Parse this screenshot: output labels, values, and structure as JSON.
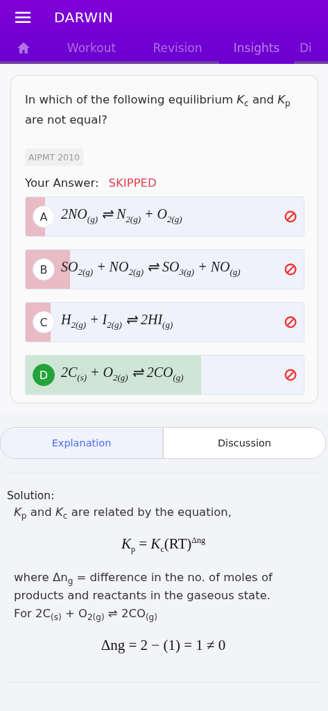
{
  "app_bar": {
    "title": "DARWIN"
  },
  "tabs": [
    {
      "kind": "home",
      "selected": false
    },
    {
      "label": "Workout",
      "selected": false
    },
    {
      "label": "Revision",
      "selected": false
    },
    {
      "label": "Insights",
      "selected": true
    },
    {
      "label": "Di",
      "selected": false
    }
  ],
  "question": {
    "text": "In which of the following equilibrium *K*$_{c}$ and *K*$_{p}$ are not equal?",
    "tag": "AIPMT 2010",
    "answer_label": "Your Answer:",
    "answer": "SKIPPED"
  },
  "options": [
    {
      "letter": "A",
      "text": "2NO$_{(g)}$ ⇌ N$_{2(g)}$ + O$_{2(g)}$",
      "correct": false,
      "level": 0.07
    },
    {
      "letter": "B",
      "text": "SO$_{2(g)}$ + NO$_{2(g)}$ ⇌ SO$_{3(g)}$ + NO$_{(g)}$",
      "correct": false,
      "level": 0.16
    },
    {
      "letter": "C",
      "text": "H$_{2(g)}$ + I$_{2(g)}$ ⇌ 2HI$_{(g)}$",
      "correct": false,
      "level": 0.09
    },
    {
      "letter": "D",
      "text": "2C$_{(s)}$ + O$_{2(g)}$ ⇌ 2CO$_{(g)}$",
      "correct": true,
      "level": 0.63
    }
  ],
  "detail_tabs": [
    {
      "label": "Explanation",
      "selected": true
    },
    {
      "label": "Discussion",
      "selected": false
    }
  ],
  "solution": {
    "heading": "Solution:",
    "lines": [
      {
        "kind": "text",
        "text": "*K*$_{p}$ and *K*$_{c}$ are related by the equation,"
      },
      {
        "kind": "equation",
        "text": "*K*$_{p}$ = *K*$_{c}$(RT)$^{Δng}$"
      },
      {
        "kind": "text",
        "text": "where Δn$_{g}$ = difference in the no. of moles of products and reactants in the gaseous state."
      },
      {
        "kind": "text",
        "text": "For 2C$_{(s)}$ + O$_{2(g)}$ ⇌ 2CO$_{(g)}$"
      },
      {
        "kind": "equation",
        "text": "Δng = 2 − (1) = 1 ≠ 0"
      }
    ]
  }
}
